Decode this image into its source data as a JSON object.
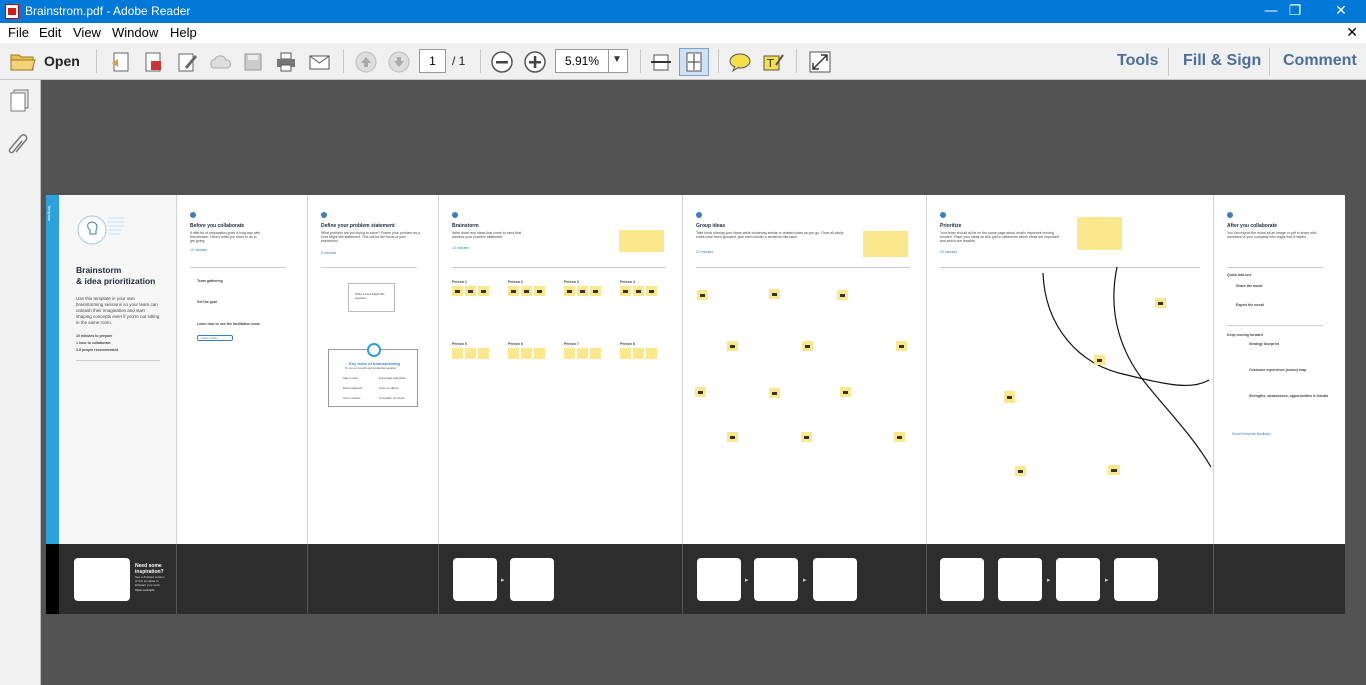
{
  "window": {
    "title": "Brainstrom.pdf - Adobe Reader",
    "minimize": "—",
    "maximize": "❐",
    "close": "✕"
  },
  "menu": {
    "items": [
      "File",
      "Edit",
      "View",
      "Window",
      "Help"
    ],
    "close": "✕"
  },
  "toolbar": {
    "open_label": "Open",
    "page_current": "1",
    "page_total": "/ 1",
    "zoom_value": "5.91%",
    "tools_label": "Tools",
    "fill_sign_label": "Fill & Sign",
    "comment_label": "Comment"
  },
  "document": {
    "intro": {
      "tag": "Template",
      "title": "Brainstorm",
      "subtitle": "& idea prioritization",
      "body": "Use this template in your own brainstorming sessions so your team can unleash their imagination and start shaping concepts even if you're not sitting in the same room.",
      "bullets": [
        "10 minutes to prepare",
        "1 hour to collaborate",
        "3-8 people recommended"
      ],
      "inspired": "Need some inspiration?",
      "inspired_body": "See a finished version of this template to kickstart your work.",
      "open_example": "Open example"
    },
    "steps": [
      {
        "number": "A",
        "title": "Before you collaborate",
        "body": "A little bit of preparation goes a long way with this session. Here's what you need to do to get going.",
        "time": "10 minutes"
      },
      {
        "number": "1",
        "title": "Define your problem statement",
        "body": "What problem are you trying to solve? Frame your problem as a How Might We statement. This will be the focus of your brainstorm.",
        "time": "5 minutes"
      },
      {
        "number": "2",
        "title": "Brainstorm",
        "body": "Write down any ideas that come to mind that address your problem statement.",
        "time": "10 minutes"
      },
      {
        "number": "3",
        "title": "Group ideas",
        "body": "Take turns sharing your ideas while clustering similar or related notes as you go. Once all sticky notes have been grouped, give each cluster a sentence-like label.",
        "time": "20 minutes"
      },
      {
        "number": "4",
        "title": "Prioritize",
        "body": "Your team should all be on the same page about what's important moving forward. Place your ideas on this grid to determine which ideas are important and which are feasible.",
        "time": "20 minutes"
      },
      {
        "number": "B",
        "title": "After you collaborate",
        "body": "You can export the mural as an image or pdf to share with members of your company who might find it helpful.",
        "time": ""
      }
    ],
    "prep_items": [
      "Team gathering",
      "Set the goal",
      "Learn how to use the facilitation tools"
    ],
    "prep_button": "Open article",
    "key_rules": {
      "title": "Key rules of brainstorming",
      "subtitle": "To run an smooth and productive session",
      "rules": [
        "Stay in topic",
        "Encourage wild ideas",
        "Defer judgment",
        "Listen to others",
        "Go for volume",
        "If possible, be visual"
      ]
    },
    "hmw_label": "Write a How Might We question",
    "persons": [
      "Person 1",
      "Person 2",
      "Person 3",
      "Person 4",
      "Person 5",
      "Person 6",
      "Person 7",
      "Person 8"
    ],
    "after": {
      "quick_add": "Quick add-ons",
      "share": "Share the mural",
      "export": "Export the mural",
      "keep_moving": "Keep moving forward",
      "links": [
        "Strategy blueprint",
        "Customer experience journey map",
        "Strengths, weaknesses, opportunities & threats"
      ],
      "feedback": "Share template feedback"
    }
  },
  "colors": {
    "titlebar": "#0078d7",
    "accent": "#3a7fc1",
    "sticky": "#fbe88c",
    "tab_text": "#4a6f9a"
  }
}
